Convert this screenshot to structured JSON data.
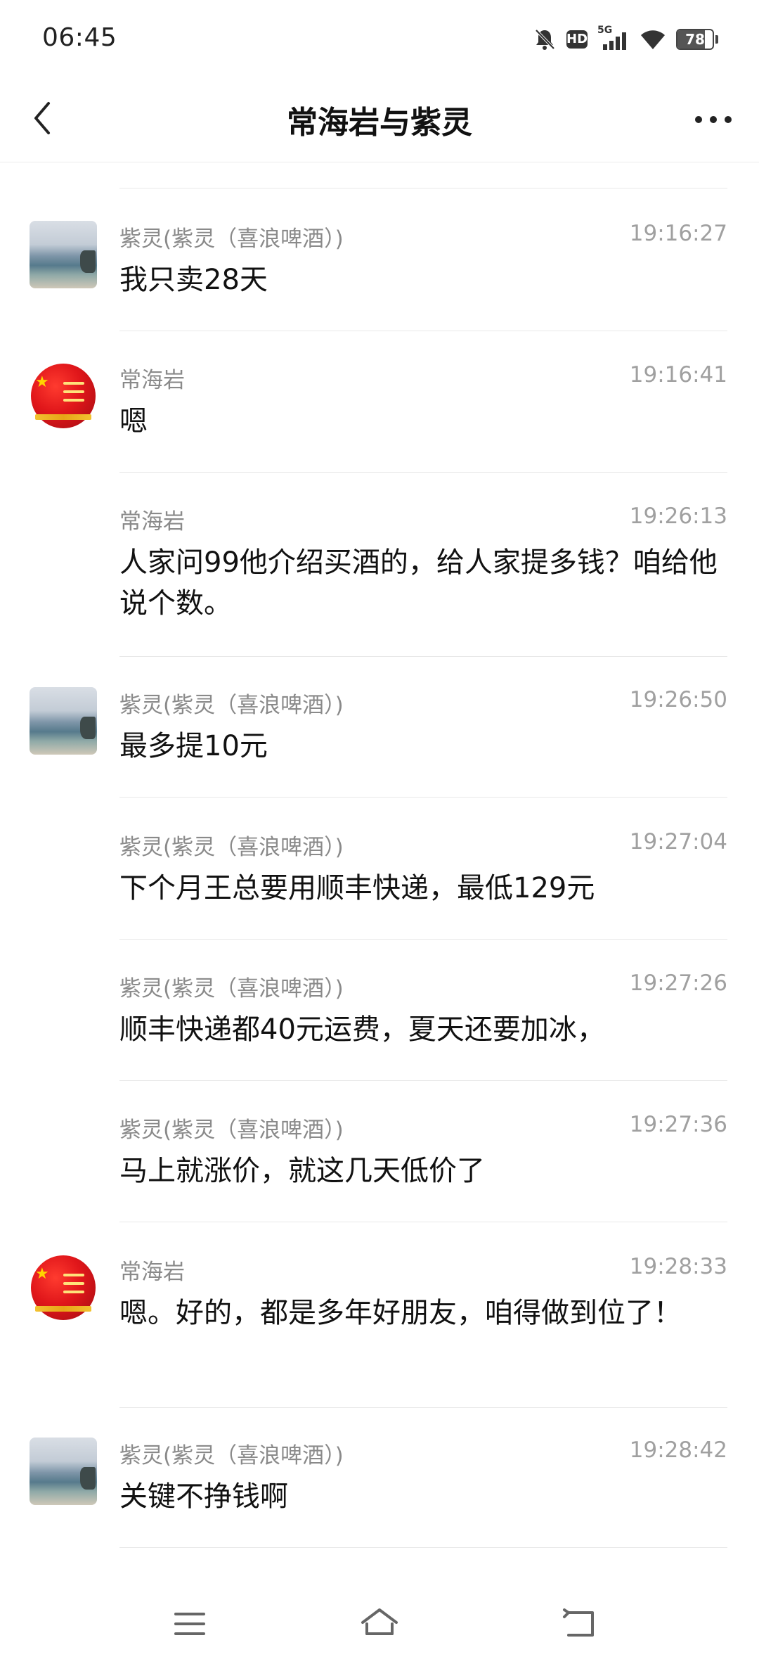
{
  "status_bar": {
    "time": "06:45",
    "network": "5G",
    "hd_label": "HD",
    "battery": "78",
    "icons": [
      "mute-bell-icon",
      "hd-icon",
      "signal-5g-icon",
      "wifi-icon",
      "battery-icon"
    ]
  },
  "header": {
    "title": "常海岩与紫灵",
    "back_icon": "chevron-left-icon",
    "more_icon": "more-dots-icon"
  },
  "messages": [
    {
      "sender": "紫灵(紫灵（喜浪啤酒）)",
      "time": "19:16:27",
      "text": "我只卖28天",
      "avatar": "sea-photo"
    },
    {
      "sender": "常海岩",
      "time": "19:16:41",
      "text": "嗯",
      "avatar": "flag-globe"
    },
    {
      "sender": "常海岩",
      "time": "19:26:13",
      "text": "人家问99他介绍买酒的，给人家提多钱？咱给他说个数。",
      "avatar": ""
    },
    {
      "sender": "紫灵(紫灵（喜浪啤酒）)",
      "time": "19:26:50",
      "text": "最多提10元",
      "avatar": "sea-photo"
    },
    {
      "sender": "紫灵(紫灵（喜浪啤酒）)",
      "time": "19:27:04",
      "text": "下个月王总要用顺丰快递，最低129元",
      "avatar": ""
    },
    {
      "sender": "紫灵(紫灵（喜浪啤酒）)",
      "time": "19:27:26",
      "text": "顺丰快递都40元运费，夏天还要加冰，",
      "avatar": ""
    },
    {
      "sender": "紫灵(紫灵（喜浪啤酒）)",
      "time": "19:27:36",
      "text": "马上就涨价，就这几天低价了",
      "avatar": ""
    },
    {
      "sender": "常海岩",
      "time": "19:28:33",
      "text": "嗯。好的，都是多年好朋友，咱得做到位了！",
      "avatar": "flag-globe"
    },
    {
      "sender": "紫灵(紫灵（喜浪啤酒）)",
      "time": "19:28:42",
      "text": "关键不挣钱啊",
      "avatar": "sea-photo"
    }
  ],
  "nav_bar": {
    "icons": [
      "menu-icon",
      "home-icon",
      "back-nav-icon"
    ]
  }
}
